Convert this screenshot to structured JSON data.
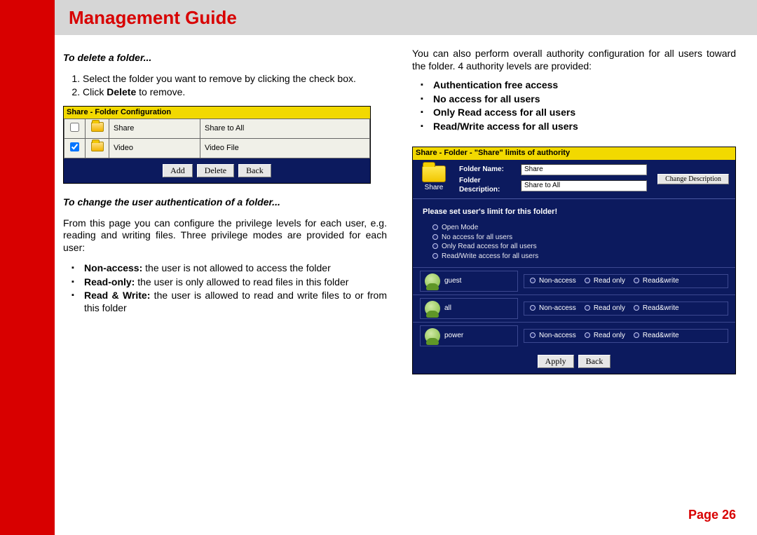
{
  "header": {
    "title": "Management Guide"
  },
  "footer": {
    "page_label": "Page 26"
  },
  "left": {
    "h1": "To delete a folder...",
    "steps": [
      "Select the folder you want to remove by clicking the check box.",
      "Click Delete to remove."
    ],
    "step2_prefix": "Click ",
    "step2_bold": "Delete",
    "step2_suffix": " to remove.",
    "h2": "To change the user authentication of a folder...",
    "p2": "From this page you can configure the privilege levels for each user, e.g. reading and writing files. Three privilege modes are provided for each user:",
    "modes": [
      {
        "b": "Non-access:",
        "t": " the user is not allowed to access the folder"
      },
      {
        "b": "Read-only:",
        "t": " the user is only allowed to read files in this folder"
      },
      {
        "b": "Read & Write:",
        "t": " the user is allowed to read and write files to or from this folder"
      }
    ]
  },
  "right": {
    "p1": "You can also perform overall authority configuration for all users toward the folder. 4 authority levels are provided:",
    "levels": [
      "Authentication free access",
      "No access for all users",
      "Only Read access for all users",
      "Read/Write access for all users"
    ]
  },
  "shot1": {
    "title": "Share - Folder Configuration",
    "rows": [
      {
        "checked": false,
        "name": "Share",
        "desc": "Share to All"
      },
      {
        "checked": true,
        "name": "Video",
        "desc": "Video File"
      }
    ],
    "buttons": {
      "add": "Add",
      "delete": "Delete",
      "back": "Back"
    }
  },
  "shot2": {
    "title": "Share - Folder - \"Share\" limits of authority",
    "folder_label": "Share",
    "fn_label": "Folder Name:",
    "fn_value": "Share",
    "fd_label": "Folder Description:",
    "fd_value": "Share to All",
    "change_btn": "Change Description",
    "prompt": "Please set user's limit for this folder!",
    "global_opts": [
      "Open Mode",
      "No access for all users",
      "Only Read access for all users",
      "Read/Write access for all users"
    ],
    "per_user_opts": [
      "Non-access",
      "Read only",
      "Read&write"
    ],
    "users": [
      "guest",
      "all",
      "power"
    ],
    "buttons": {
      "apply": "Apply",
      "back": "Back"
    }
  }
}
